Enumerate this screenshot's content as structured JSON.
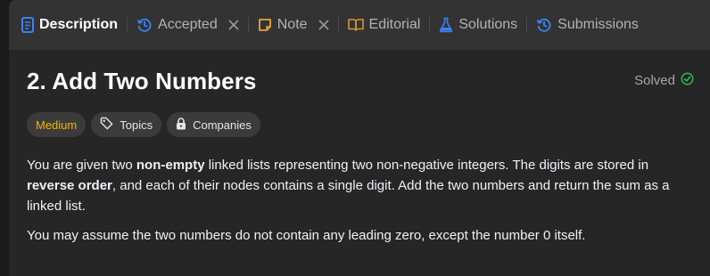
{
  "tabs": [
    {
      "label": "Description",
      "icon": "description-icon",
      "active": true
    },
    {
      "label": "Accepted",
      "icon": "history-icon",
      "closable": true
    },
    {
      "label": "Note",
      "icon": "note-icon",
      "closable": true
    },
    {
      "label": "Editorial",
      "icon": "book-icon"
    },
    {
      "label": "Solutions",
      "icon": "flask-icon"
    },
    {
      "label": "Submissions",
      "icon": "history-icon"
    }
  ],
  "problem": {
    "title": "2. Add Two Numbers",
    "status": "Solved"
  },
  "tags": {
    "difficulty": "Medium",
    "topics": "Topics",
    "companies": "Companies"
  },
  "description": {
    "p1": {
      "t1": "You are given two ",
      "b1": "non-empty",
      "t2": " linked lists representing two non-negative integers. The digits are stored in ",
      "b2": "reverse order",
      "t3": ", and each of their nodes contains a single digit. Add the two numbers and return the sum as a linked list."
    },
    "p2": "You may assume the two numbers do not contain any leading zero, except the number 0 itself."
  },
  "colors": {
    "tab_bar": "#333333",
    "panel": "#262626",
    "accent_blue": "#3b82f6",
    "medium": "#f5b400",
    "solved_green": "#2cbb5d",
    "note_orange": "#e8a33d",
    "editorial_orange": "#d9913a"
  }
}
